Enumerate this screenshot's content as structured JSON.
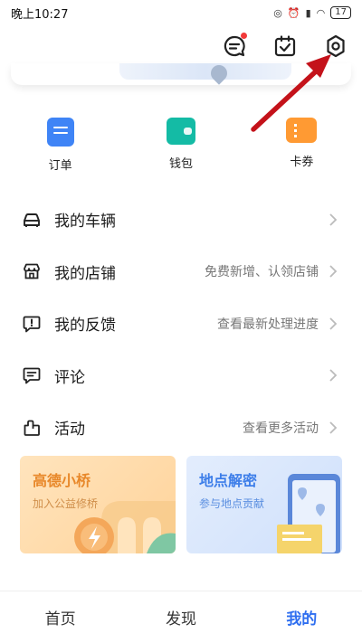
{
  "status_bar": {
    "time": "晚上10:27",
    "battery": "17"
  },
  "topbar": {
    "icons": [
      "message-icon",
      "checklist-icon",
      "settings-icon"
    ],
    "notification_dot_color": "#f23a3a"
  },
  "quick_actions": [
    {
      "label": "订单",
      "icon": "order-icon",
      "color": "#3f84f6"
    },
    {
      "label": "钱包",
      "icon": "wallet-icon",
      "color": "#14bba5"
    },
    {
      "label": "卡券",
      "icon": "coupon-icon",
      "color": "#ff9a33"
    }
  ],
  "menu": [
    {
      "label": "我的车辆",
      "hint": "",
      "icon": "car-icon"
    },
    {
      "label": "我的店铺",
      "hint": "免费新增、认领店铺",
      "icon": "store-icon"
    },
    {
      "label": "我的反馈",
      "hint": "查看最新处理进度",
      "icon": "feedback-icon"
    },
    {
      "label": "评论",
      "hint": "",
      "icon": "comment-icon"
    },
    {
      "label": "活动",
      "hint": "查看更多活动",
      "icon": "activity-icon"
    }
  ],
  "promos": [
    {
      "title": "高德小桥",
      "subtitle": "加入公益修桥"
    },
    {
      "title": "地点解密",
      "subtitle": "参与地点贡献"
    }
  ],
  "tabbar": {
    "tabs": [
      "首页",
      "发现",
      "我的"
    ],
    "active": "我的",
    "active_color": "#2f6ff0"
  },
  "annotation": {
    "arrow_color": "#c4121a"
  }
}
